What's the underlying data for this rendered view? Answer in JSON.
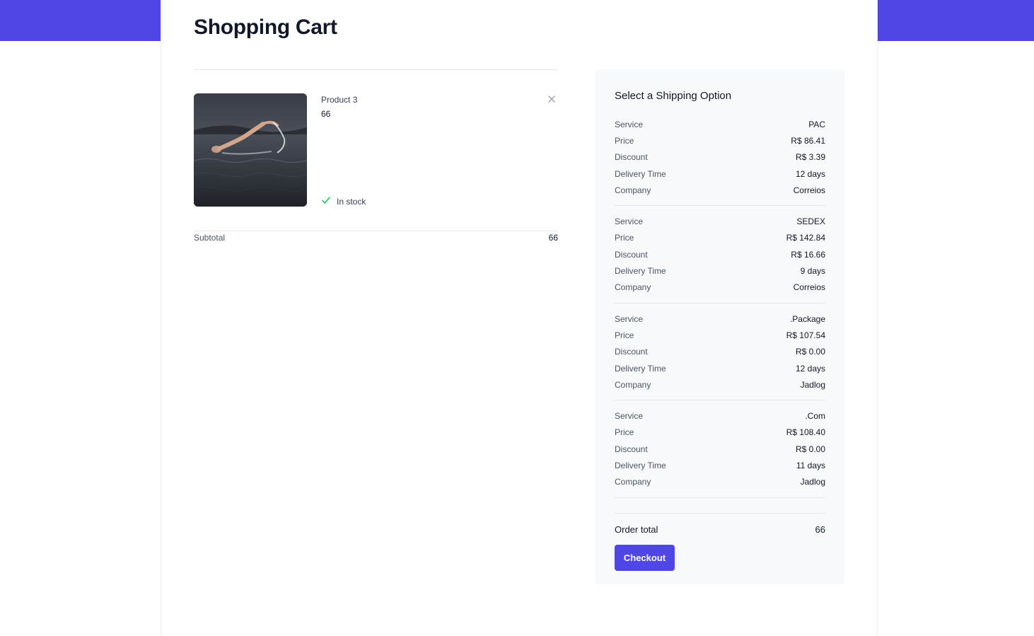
{
  "page": {
    "title": "Shopping Cart"
  },
  "cart": {
    "items": [
      {
        "name": "Product 3",
        "price": "66",
        "stock_status": "In stock",
        "image": "swimmer-photo"
      }
    ],
    "subtotal_label": "Subtotal",
    "subtotal_value": "66"
  },
  "shipping": {
    "title": "Select a Shipping Option",
    "labels": {
      "service": "Service",
      "price": "Price",
      "discount": "Discount",
      "delivery_time": "Delivery Time",
      "company": "Company"
    },
    "options": [
      {
        "service": "PAC",
        "price": "R$ 86.41",
        "discount": "R$ 3.39",
        "delivery_time": "12 days",
        "company": "Correios"
      },
      {
        "service": "SEDEX",
        "price": "R$ 142.84",
        "discount": "R$ 16.66",
        "delivery_time": "9 days",
        "company": "Correios"
      },
      {
        "service": ".Package",
        "price": "R$ 107.54",
        "discount": "R$ 0.00",
        "delivery_time": "12 days",
        "company": "Jadlog"
      },
      {
        "service": ".Com",
        "price": "R$ 108.40",
        "discount": "R$ 0.00",
        "delivery_time": "11 days",
        "company": "Jadlog"
      }
    ],
    "order_total_label": "Order total",
    "order_total_value": "66",
    "checkout_label": "Checkout"
  },
  "colors": {
    "brand": "#4f46e5",
    "success": "#22c55e",
    "panel_bg": "#f8f9fb"
  },
  "icons": {
    "remove": "close-icon",
    "stock": "check-icon"
  }
}
